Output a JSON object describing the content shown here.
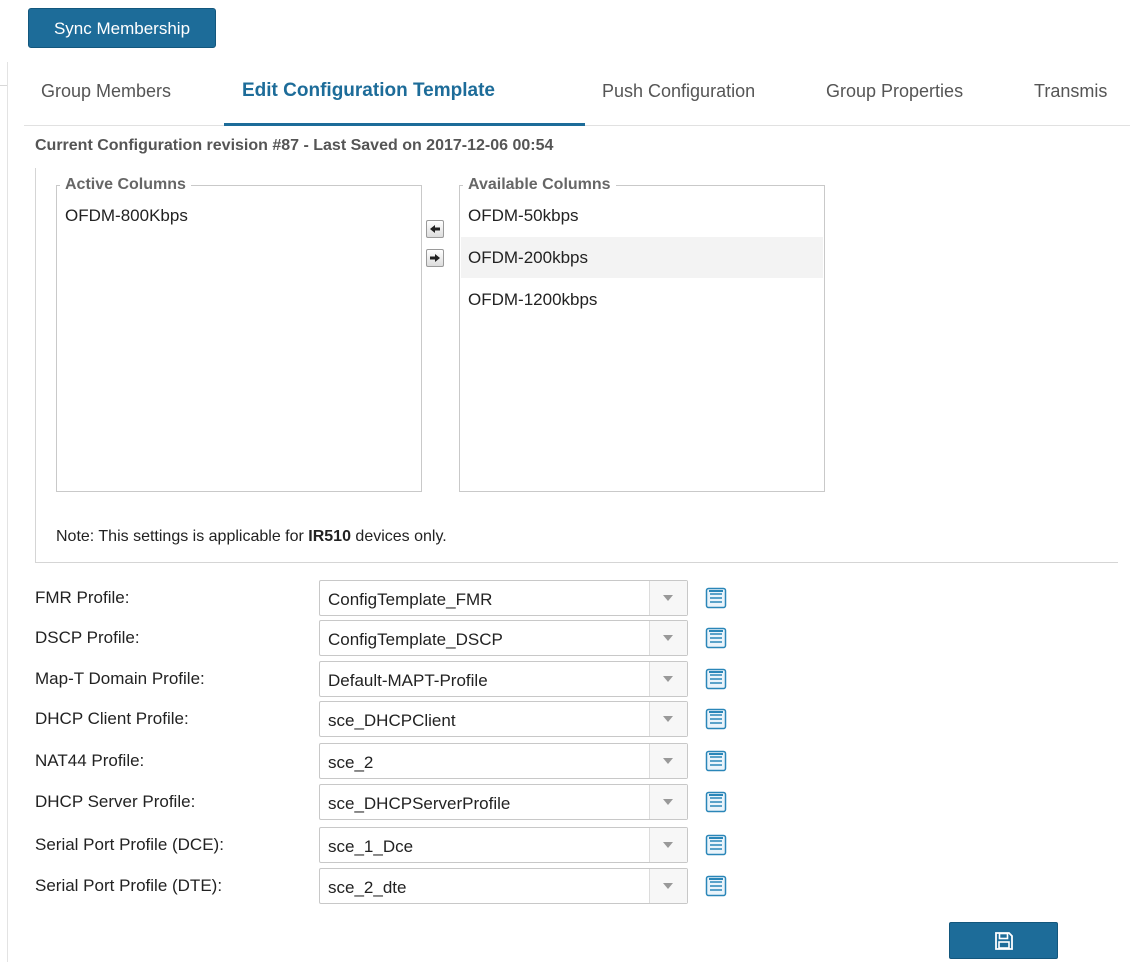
{
  "toolbar": {
    "sync_label": "Sync Membership"
  },
  "tabs": [
    {
      "label": "Group Members"
    },
    {
      "label": "Edit Configuration Template",
      "active": true
    },
    {
      "label": "Push Configuration"
    },
    {
      "label": "Group Properties"
    },
    {
      "label": "Transmis"
    }
  ],
  "revision_text": "Current Configuration revision #87 - Last Saved on 2017-12-06 00:54",
  "active_columns": {
    "legend": "Active Columns",
    "items": [
      "OFDM-800Kbps"
    ]
  },
  "available_columns": {
    "legend": "Available Columns",
    "items": [
      "OFDM-50kbps",
      "OFDM-200kbps",
      "OFDM-1200kbps"
    ]
  },
  "note": {
    "prefix": "Note: This settings is applicable for ",
    "device": "IR510",
    "suffix": " devices only."
  },
  "profiles": [
    {
      "label": "FMR Profile:",
      "value": "ConfigTemplate_FMR"
    },
    {
      "label": "DSCP Profile:",
      "value": "ConfigTemplate_DSCP"
    },
    {
      "label": "Map-T Domain Profile:",
      "value": "Default-MAPT-Profile"
    },
    {
      "label": "DHCP Client Profile:",
      "value": "sce_DHCPClient"
    },
    {
      "label": "NAT44 Profile:",
      "value": "sce_2"
    },
    {
      "label": "DHCP Server Profile:",
      "value": "sce_DHCPServerProfile"
    },
    {
      "label": "Serial Port Profile (DCE):",
      "value": "sce_1_Dce"
    },
    {
      "label": "Serial Port Profile (DTE):",
      "value": "sce_2_dte"
    }
  ],
  "icons": {
    "move_left": "arrow-left-icon",
    "move_right": "arrow-right-icon",
    "edit_profile": "edit-list-icon",
    "save": "floppy-disk-icon"
  },
  "colors": {
    "accent": "#1d6c99"
  }
}
